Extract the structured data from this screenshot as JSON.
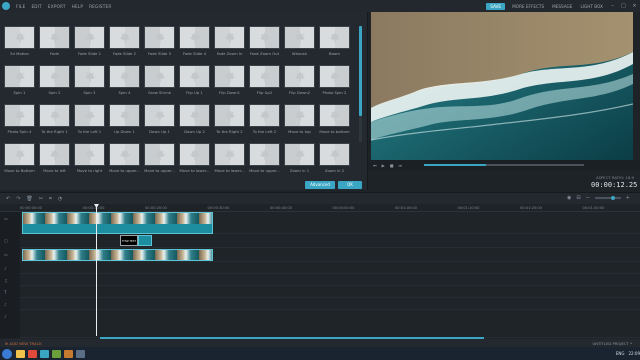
{
  "menu": {
    "items": [
      "FILE",
      "EDIT",
      "EXPORT",
      "HELP",
      "REGISTER"
    ],
    "save": "SAVE",
    "right_links": [
      "MORE EFFECTS",
      "MESSAGE",
      "LIGHT BOX"
    ]
  },
  "transitions": [
    {
      "label": "3d Motion"
    },
    {
      "label": "Fade"
    },
    {
      "label": "Fade Slide 1"
    },
    {
      "label": "Fade Slide 2"
    },
    {
      "label": "Fade Slide 3"
    },
    {
      "label": "Fade Slide 4"
    },
    {
      "label": "Fade Zoom In"
    },
    {
      "label": "Fade Zoom Out"
    },
    {
      "label": "Whoosh"
    },
    {
      "label": "Boom"
    },
    {
      "label": "Spin 1"
    },
    {
      "label": "Spin 2"
    },
    {
      "label": "Spin 3"
    },
    {
      "label": "Spin 4"
    },
    {
      "label": "Grow Shrink"
    },
    {
      "label": "Flip Up 1"
    },
    {
      "label": "Flip Down1"
    },
    {
      "label": "Flip Up2"
    },
    {
      "label": "Flip Down2"
    },
    {
      "label": "Photo Spin 2"
    },
    {
      "label": "Photo Spin 4"
    },
    {
      "label": "To the Right 1"
    },
    {
      "label": "To the Left 1"
    },
    {
      "label": "Up Down 1"
    },
    {
      "label": "Down Up 1"
    },
    {
      "label": "Down Up 2"
    },
    {
      "label": "To the Right 2"
    },
    {
      "label": "To the Left 2"
    },
    {
      "label": "Move to top"
    },
    {
      "label": "Move to bottom"
    },
    {
      "label": "Move to Bottom"
    },
    {
      "label": "Move to left"
    },
    {
      "label": "Move to right"
    },
    {
      "label": "Move to upper..."
    },
    {
      "label": "Move to upper..."
    },
    {
      "label": "Move to lower..."
    },
    {
      "label": "Move to lower..."
    },
    {
      "label": "Move to upper..."
    },
    {
      "label": "Zoom in 1"
    },
    {
      "label": "Zoom in 2"
    }
  ],
  "buttons": {
    "advanced": "Advanced",
    "ok": "OK"
  },
  "preview": {
    "aspect": "ASPECT RATIO: 16:9",
    "timecode": "00:00:12.25",
    "progress": 0.39
  },
  "ruler": {
    "ticks": [
      "00:00:00:00",
      "00:00:10:00",
      "00:00:20:00",
      "00:00:30:00",
      "00:00:40:00",
      "00:00:50:00",
      "00:01:00:00",
      "00:01:10:00",
      "00:01:20:00",
      "00:01:30:00"
    ]
  },
  "title_clip": "TITLE TEXT",
  "bottom": {
    "add_track": "ADD NEW TRACK",
    "project": "UNTITLED PROJECT *"
  },
  "taskbar": {
    "time": "22:09",
    "lang": "ENG"
  }
}
